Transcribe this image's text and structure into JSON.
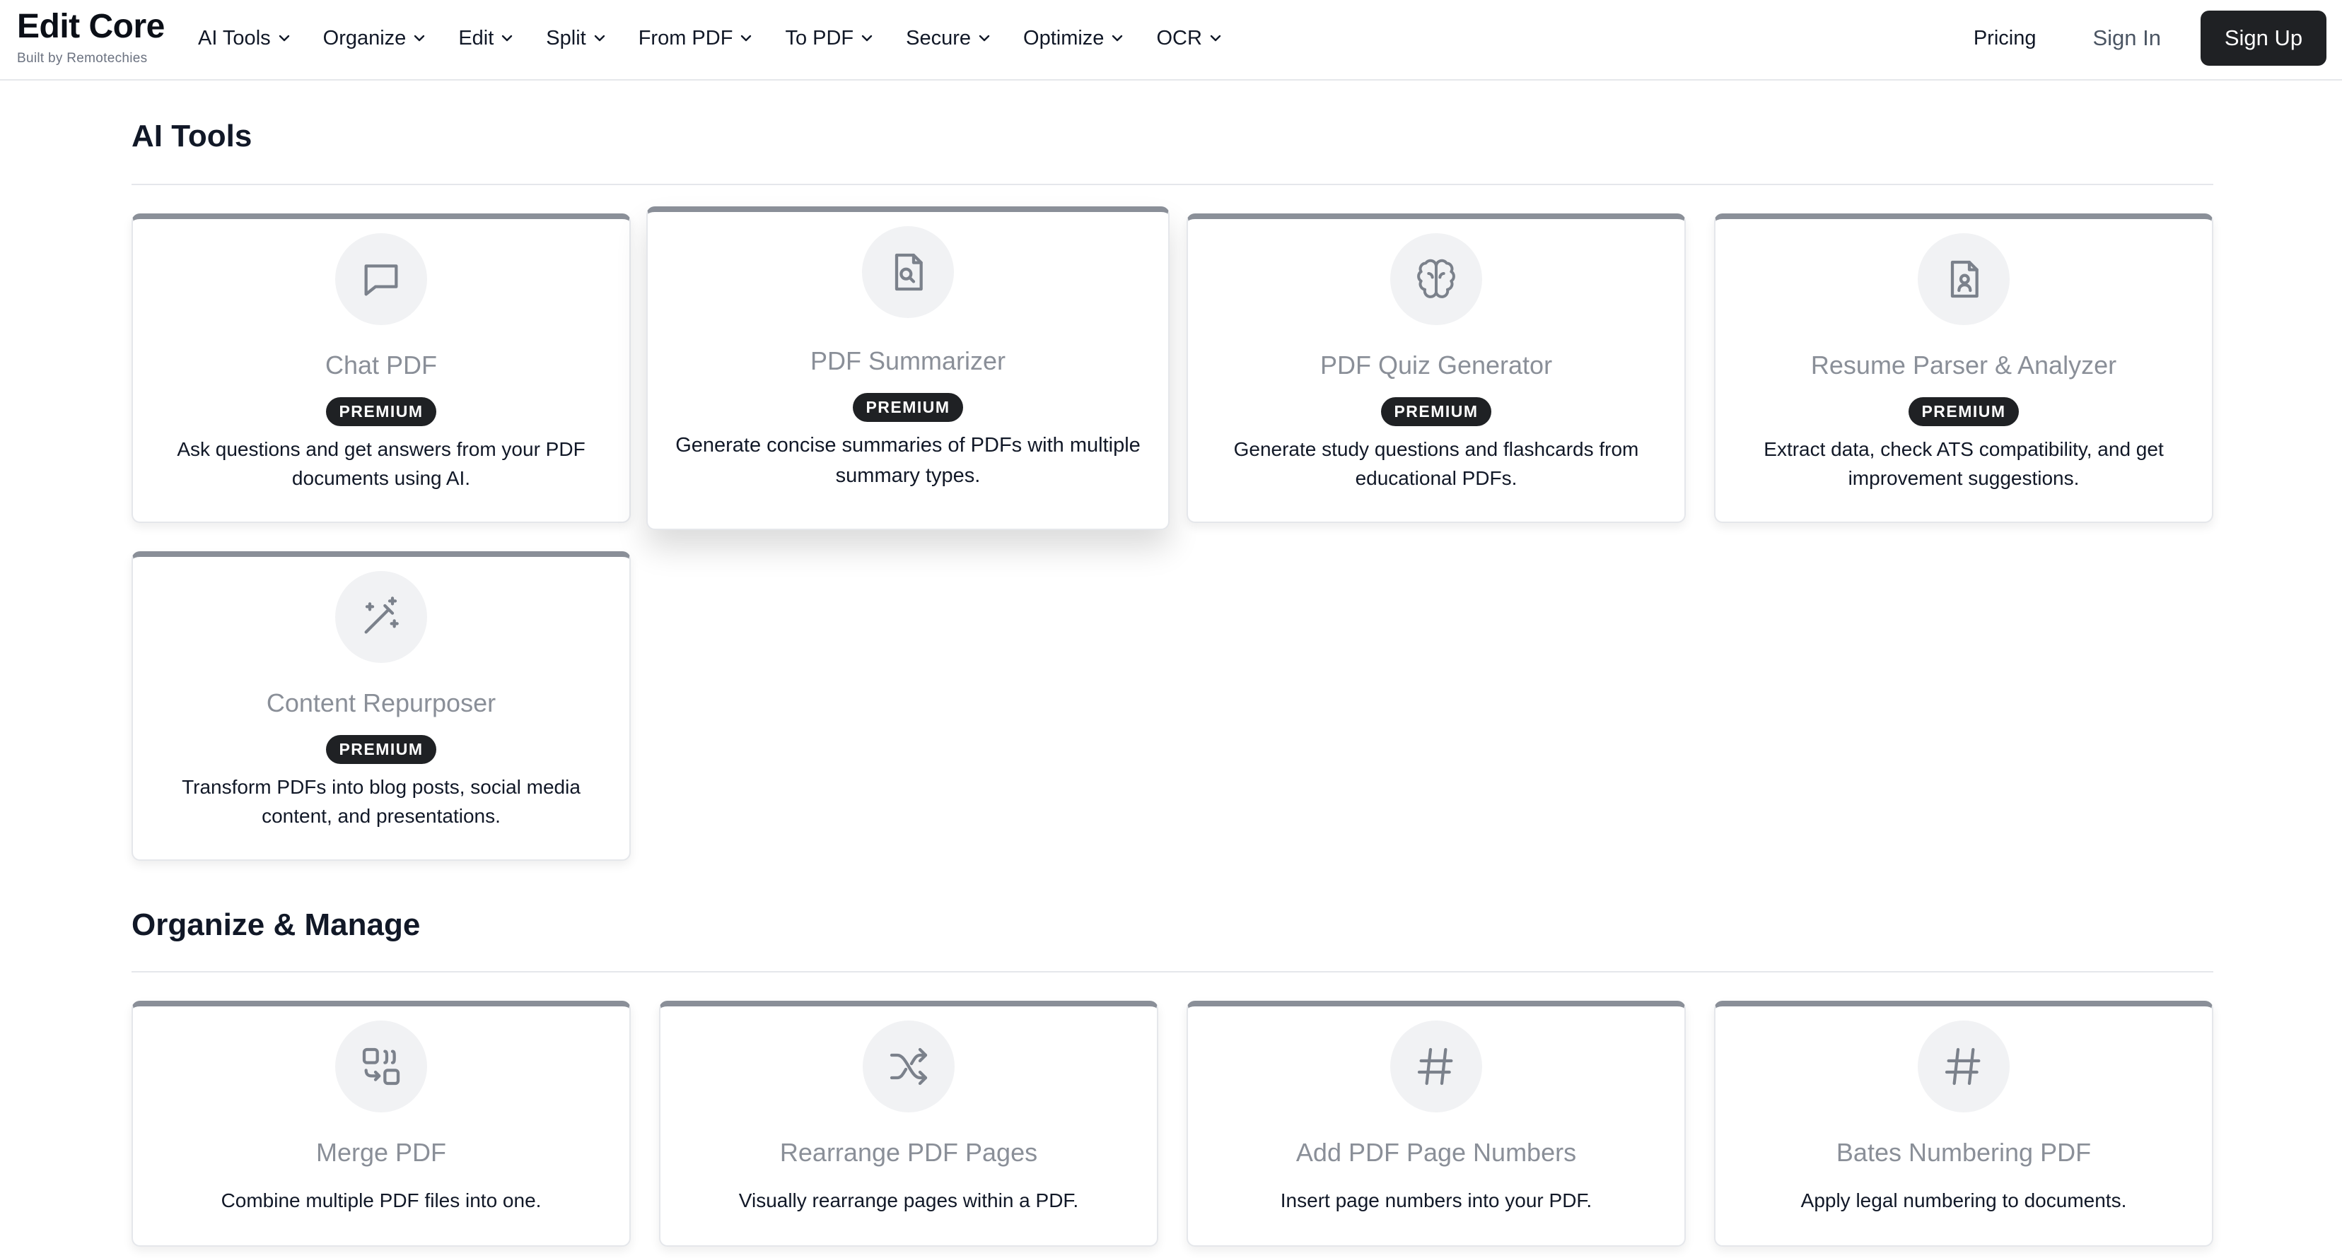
{
  "brand": {
    "name": "Edit Core",
    "tagline": "Built by Remotechies"
  },
  "nav": {
    "items": [
      "AI Tools",
      "Organize",
      "Edit",
      "Split",
      "From PDF",
      "To PDF",
      "Secure",
      "Optimize",
      "OCR"
    ],
    "pricing": "Pricing",
    "sign_in": "Sign In",
    "sign_up": "Sign Up"
  },
  "sections": [
    {
      "title": "AI Tools",
      "cards": [
        {
          "title": "Chat PDF",
          "badge": "PREMIUM",
          "desc": "Ask questions and get answers from your PDF documents using AI.",
          "icon": "chat-bubble-icon"
        },
        {
          "title": "PDF Summarizer",
          "badge": "PREMIUM",
          "desc": "Generate concise summaries of PDFs with multiple summary types.",
          "icon": "file-search-icon"
        },
        {
          "title": "PDF Quiz Generator",
          "badge": "PREMIUM",
          "desc": "Generate study questions and flashcards from educational PDFs.",
          "icon": "brain-icon"
        },
        {
          "title": "Resume Parser & Analyzer",
          "badge": "PREMIUM",
          "desc": "Extract data, check ATS compatibility, and get improvement suggestions.",
          "icon": "file-user-icon"
        },
        {
          "title": "Content Repurposer",
          "badge": "PREMIUM",
          "desc": "Transform PDFs into blog posts, social media content, and presentations.",
          "icon": "magic-wand-icon"
        }
      ]
    },
    {
      "title": "Organize & Manage",
      "cards": [
        {
          "title": "Merge PDF",
          "desc": "Combine multiple PDF files into one.",
          "icon": "merge-icon"
        },
        {
          "title": "Rearrange PDF Pages",
          "desc": "Visually rearrange pages within a PDF.",
          "icon": "shuffle-icon"
        },
        {
          "title": "Add PDF Page Numbers",
          "desc": "Insert page numbers into your PDF.",
          "icon": "hash-icon"
        },
        {
          "title": "Bates Numbering PDF",
          "desc": "Apply legal numbering to documents.",
          "icon": "hash-icon"
        }
      ]
    }
  ],
  "colors": {
    "accent_dark": "#1f2124",
    "card_top_border": "#8a8f98",
    "muted_title": "#8a8f98"
  }
}
